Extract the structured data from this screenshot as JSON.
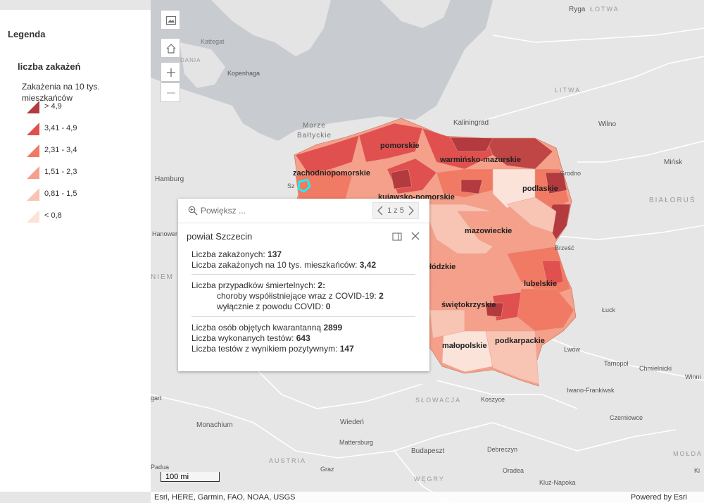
{
  "legend": {
    "heading": "Legenda",
    "layer_title": "liczba zakażeń",
    "field_title": "Zakażenia na 10 tys. mieszkańców",
    "classes": [
      {
        "label": "> 4,9",
        "color": "#b33a3e"
      },
      {
        "label": "3,41 - 4,9",
        "color": "#e0504f"
      },
      {
        "label": "2,31 - 3,4",
        "color": "#f07a63"
      },
      {
        "label": "1,51 - 2,3",
        "color": "#f5a08a"
      },
      {
        "label": "0,81 - 1,5",
        "color": "#f8c4b4"
      },
      {
        "label": "< 0,8",
        "color": "#fbe3da"
      }
    ]
  },
  "controls": {
    "basemap_icon": "basemap-gallery-icon",
    "home_icon": "home-icon",
    "zoom_in_icon": "plus-icon",
    "zoom_out_icon": "minus-icon"
  },
  "popup": {
    "zoom_label": "Powiększ ...",
    "pager": "1 z 5",
    "title": "powiat Szczecin",
    "cases_label": "Liczba zakażonych:",
    "cases_value": "137",
    "per10k_label": "Liczba zakażonych na 10 tys. mieszkańców:",
    "per10k_value": "3,42",
    "deaths_label": "Liczba przypadków śmiertelnych:",
    "deaths_value": "2:",
    "comorb_label": "choroby współistniejące wraz z COVID-19:",
    "comorb_value": "2",
    "covid_only_label": "wyłącznie z powodu COVID:",
    "covid_only_value": "0",
    "quarantine_label": "Liczba osób objętych kwarantanną",
    "quarantine_value": "2899",
    "tests_label": "Liczba wykonanych testów:",
    "tests_value": "643",
    "positive_label": "Liczba testów z wynikiem pozytywnym:",
    "positive_value": "147"
  },
  "map_labels": {
    "voivodeships": [
      "pomorskie",
      "zachodniopomorskie",
      "warmińsko-mazurskie",
      "podlaskie",
      "kujawsko-pomorskie",
      "mazowieckie",
      "łódzkie",
      "lubelskie",
      "świętokrzyskie",
      "małopolskie",
      "podkarpackie"
    ],
    "cities": [
      "Ryga",
      "Kopenhaga",
      "Kaliningrad",
      "Wilno",
      "Mińsk",
      "Hamburg",
      "Grodno",
      "Brześć",
      "Hanower",
      "Łuck",
      "Lwów",
      "Tarnopol",
      "Chmielnicki",
      "Winni",
      "Iwano-Frankiwsk",
      "Koszyce",
      "Wiedeń",
      "Monachium",
      "Mattersburg",
      "Budapeszt",
      "Debreczyn",
      "Oradea",
      "Graz",
      "Czerniowce",
      "Kluż-Napoka",
      "Sz",
      "Ki",
      "gart",
      "Padua",
      "Kattegat"
    ],
    "sea": [
      "Morze",
      "Bałtyckie"
    ],
    "countries": [
      "ŁOTWA",
      "LITWA",
      "BIAŁORUŚ",
      "NIEM",
      "SŁOWACJA",
      "AUSTRIA",
      "WĘGRY",
      "MOŁDA",
      "DANIA"
    ]
  },
  "scale_label": "100 mi",
  "attribution": "Esri, HERE, Garmin, FAO, NOAA, USGS",
  "powered_by": "Powered by Esri"
}
